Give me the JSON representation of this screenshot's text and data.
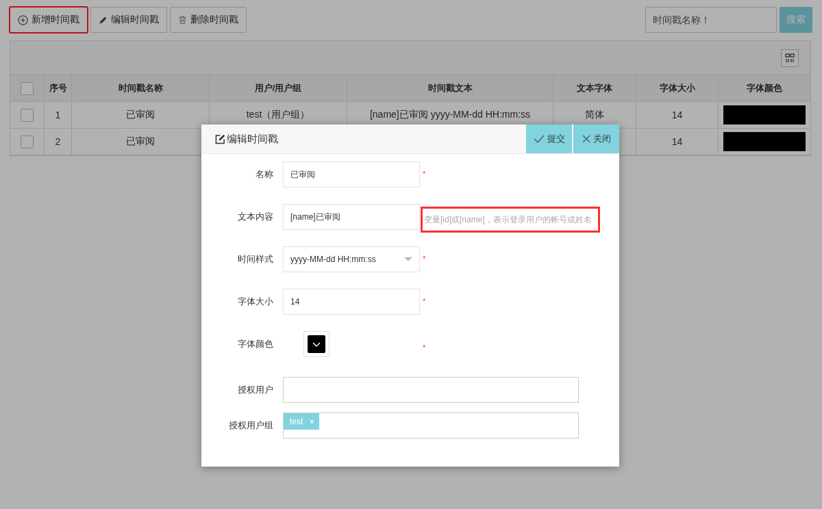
{
  "toolbar": {
    "buttons": [
      {
        "kind": "add",
        "label": "新增时间戳",
        "highlighted": true
      },
      {
        "kind": "edit",
        "label": "编辑时间戳",
        "highlighted": false
      },
      {
        "kind": "delete",
        "label": "删除时间戳",
        "highlighted": false
      }
    ],
    "search": {
      "placeholder": "时间戳名称！",
      "button": "搜索"
    }
  },
  "table": {
    "all_checked": false,
    "columns": [
      "序号",
      "时间戳名称",
      "用户/用户组",
      "时间戳文本",
      "文本字体",
      "字体大小",
      "字体颜色"
    ],
    "rows": [
      {
        "checked": false,
        "cells": [
          "1",
          "已审阅",
          "test（用户组）",
          "[name]已审阅 yyyy-MM-dd HH:mm:ss",
          "简体",
          "14"
        ],
        "color": "#000000"
      },
      {
        "checked": false,
        "cells": [
          "2",
          "已审阅",
          null,
          null,
          null,
          "14"
        ],
        "color": "#000000"
      }
    ]
  },
  "dialog": {
    "title": "编辑时间戳",
    "buttons": [
      {
        "kind": "submit",
        "label": "提交"
      },
      {
        "kind": "close",
        "label": "关闭"
      }
    ],
    "fields": [
      {
        "kind": "text",
        "label": "名称",
        "value": "已审阅",
        "required_mark": "*"
      },
      {
        "kind": "text",
        "label": "文本内容",
        "value": "[name]已审阅",
        "hint": "变量[id]或[name]，表示登录用户的帐号或姓名",
        "hint_highlighted": true
      },
      {
        "kind": "select",
        "label": "时间样式",
        "value": "yyyy-MM-dd HH:mm:ss",
        "required_mark": "*"
      },
      {
        "kind": "text",
        "label": "字体大小",
        "value": "14",
        "required_mark": "*"
      },
      {
        "kind": "color",
        "label": "字体颜色",
        "color": "#000000",
        "required_mark": "*"
      },
      {
        "kind": "tags",
        "label": "授权用户"
      },
      {
        "kind": "tags",
        "label": "授权用户组",
        "tags": [
          {
            "label": "test",
            "remove": "×"
          }
        ]
      }
    ]
  }
}
